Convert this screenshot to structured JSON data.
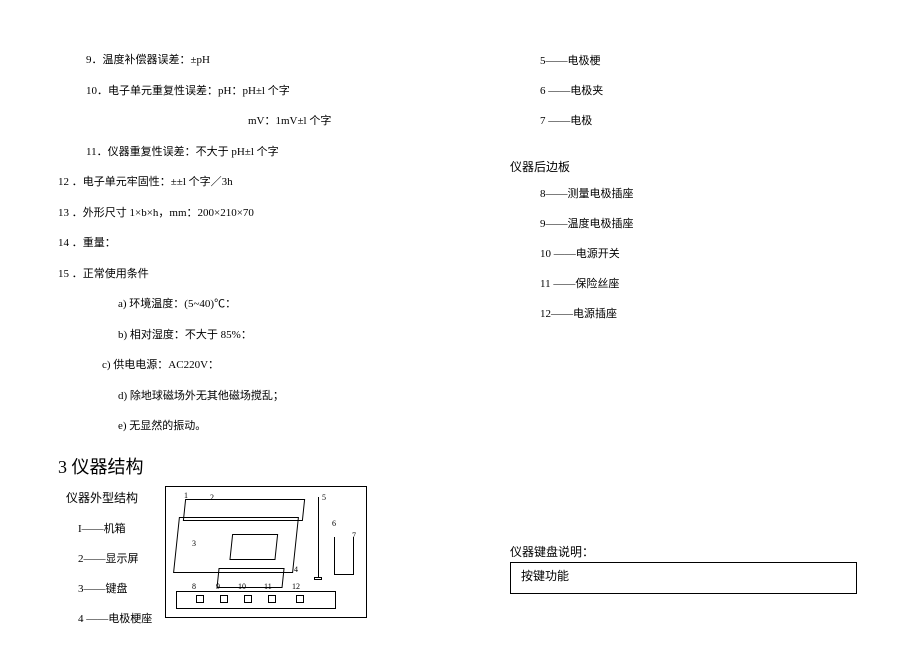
{
  "left": {
    "items": [
      "9．温度补偿器误差：±pH",
      "10．电子单元重复性误差：pH：pH±l 个字",
      "mV：1mV±l 个字",
      "11．仪器重复性误差：不大于 pH±l 个字",
      "12   ．电子单元牢固性：±±l 个字／3h",
      "13   ．外形尺寸 1×b×h，mm：200×210×70",
      "14   ．重量：",
      "15   ．正常使用条件",
      "a)   环境温度：(5~40)℃：",
      "b)   相对湿度：不大于 85%：",
      "c)        供电电源：AC220V：",
      "d)   除地球磁场外无其他磁场搅乱；",
      "e)   无显然的振动。"
    ],
    "section_heading": "3   仪器结构",
    "sub1": "仪器外型结构",
    "legend1": [
      "I——机箱",
      "2——显示屏",
      "3——键盘",
      "4   ——电极梗座"
    ]
  },
  "right": {
    "list_top": [
      "5——电极梗",
      "6   ——电极夹",
      "7   ——电极"
    ],
    "sub2": "仪器后边板",
    "list_bottom": [
      "8——测量电极插座",
      "9——温度电极插座",
      "10  ——电源开关",
      "11 ——保险丝座",
      "12——电源插座"
    ],
    "table_title": "仪器键盘说明：",
    "table_cell": "按键功能"
  }
}
